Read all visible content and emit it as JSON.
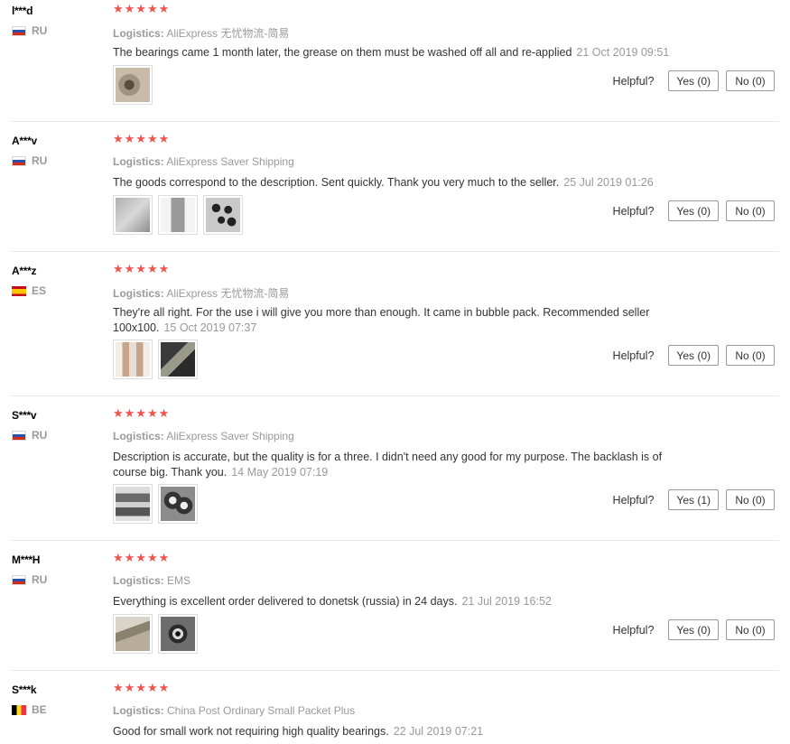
{
  "helpful_label": "Helpful?",
  "logistics_label": "Logistics:",
  "stars": "★★★★★",
  "colors": {
    "star": "#f2544b",
    "muted": "#999999",
    "divider": "#e8e8e8"
  },
  "reviews": [
    {
      "user": "l***d",
      "country": "RU",
      "flag": "ru",
      "logistics": "AliExpress 无忧物流-简易",
      "text": "The bearings came 1 month later, the grease on them must be washed off all and re-applied",
      "date": "21 Oct 2019 09:51",
      "yes": "Yes (0)",
      "no": "No (0)"
    },
    {
      "user": "A***v",
      "country": "RU",
      "flag": "ru",
      "logistics": "AliExpress Saver Shipping",
      "text": "The goods correspond to the description. Sent quickly. Thank you very much to the seller.",
      "date": "25 Jul 2019 01:26",
      "yes": "Yes (0)",
      "no": "No (0)"
    },
    {
      "user": "A***z",
      "country": "ES",
      "flag": "es",
      "logistics": "AliExpress 无忧物流-简易",
      "text": "They're all right. For the use i will give you more than enough. It came in bubble pack. Recommended seller 100x100.",
      "date": "15 Oct 2019 07:37",
      "yes": "Yes (0)",
      "no": "No (0)"
    },
    {
      "user": "S***v",
      "country": "RU",
      "flag": "ru",
      "logistics": "AliExpress Saver Shipping",
      "text": "Description is accurate, but the quality is for a three. I didn't need any good for my purpose. The backlash is of course big. Thank you.",
      "date": "14 May 2019 07:19",
      "yes": "Yes (1)",
      "no": "No (0)"
    },
    {
      "user": "M***H",
      "country": "RU",
      "flag": "ru",
      "logistics": "EMS",
      "text": "Everything is excellent order delivered to donetsk (russia) in 24 days.",
      "date": "21 Jul 2019 16:52",
      "yes": "Yes (0)",
      "no": "No (0)"
    },
    {
      "user": "S***k",
      "country": "BE",
      "flag": "be",
      "logistics": "China Post Ordinary Small Packet Plus",
      "text": "Good for small work not requiring high quality bearings.",
      "date": "22 Jul 2019 07:21"
    }
  ]
}
